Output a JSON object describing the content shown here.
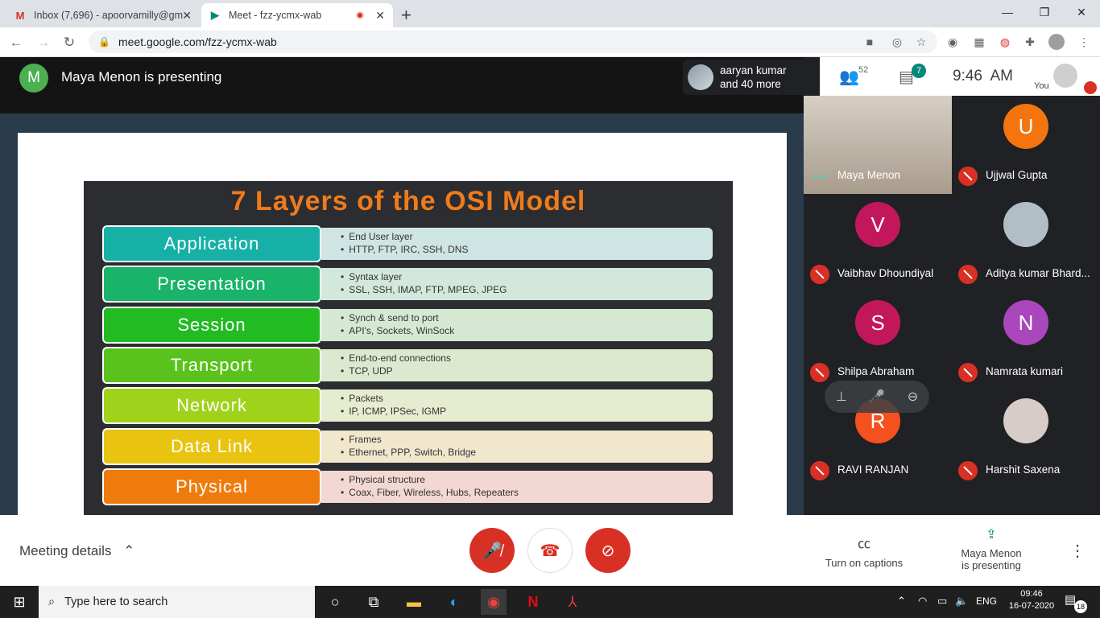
{
  "browser": {
    "tabs": [
      {
        "title": "Inbox (7,696) - apoorvamilly@gm",
        "icon": "gmail-icon"
      },
      {
        "title": "Meet - fzz-ycmx-wab",
        "icon": "meet-icon"
      }
    ],
    "url": "meet.google.com/fzz-ycmx-wab"
  },
  "meet": {
    "presenter_initial": "M",
    "presenting_title": "Maya Menon is presenting",
    "people_preview": "aaryan kumar",
    "people_more": "and 40 more",
    "participant_count": "52",
    "chat_count": "7",
    "time": "9:46  AM",
    "self_label": "You"
  },
  "slide": {
    "title": "7 Layers of the OSI Model",
    "layers": [
      {
        "name": "Application",
        "color": "#16b0a7",
        "desc_bg": "#cfe5e3",
        "items": [
          "End User layer",
          "HTTP, FTP, IRC, SSH, DNS"
        ]
      },
      {
        "name": "Presentation",
        "color": "#19b36a",
        "desc_bg": "#d3e8dc",
        "items": [
          "Syntax layer",
          "SSL, SSH, IMAP, FTP, MPEG, JPEG"
        ]
      },
      {
        "name": "Session",
        "color": "#22bb22",
        "desc_bg": "#d5e9d2",
        "items": [
          "Synch & send to port",
          "API's, Sockets, WinSock"
        ]
      },
      {
        "name": "Transport",
        "color": "#5ac21c",
        "desc_bg": "#dde9cf",
        "items": [
          "End-to-end connections",
          "TCP, UDP"
        ]
      },
      {
        "name": "Network",
        "color": "#9fd21a",
        "desc_bg": "#e6eccf",
        "items": [
          "Packets",
          "IP, ICMP, IPSec, IGMP"
        ]
      },
      {
        "name": "Data Link",
        "color": "#e8c411",
        "desc_bg": "#f0e7cd",
        "items": [
          "Frames",
          "Ethernet, PPP, Switch, Bridge"
        ]
      },
      {
        "name": "Physical",
        "color": "#f07b0d",
        "desc_bg": "#f3d7d2",
        "items": [
          "Physical structure",
          "Coax, Fiber, Wireless, Hubs, Repeaters"
        ]
      }
    ]
  },
  "participants": [
    {
      "name": "Maya Menon",
      "initial": "",
      "color": "",
      "video": true,
      "muted": false
    },
    {
      "name": "Ujjwal Gupta",
      "initial": "U",
      "color": "#f4750f",
      "video": false,
      "muted": true
    },
    {
      "name": "Vaibhav Dhoundiyal",
      "initial": "V",
      "color": "#c2185b",
      "video": false,
      "muted": true
    },
    {
      "name": "Aditya kumar Bhard...",
      "initial": "",
      "color": "#b0bec5",
      "video": false,
      "muted": true
    },
    {
      "name": "Shilpa Abraham",
      "initial": "S",
      "color": "#c2185b",
      "video": false,
      "muted": true
    },
    {
      "name": "Namrata kumari",
      "initial": "N",
      "color": "#ab47bc",
      "video": false,
      "muted": true
    },
    {
      "name": "RAVI RANJAN",
      "initial": "R",
      "color": "#f4511e",
      "video": false,
      "muted": true
    },
    {
      "name": "Harshit Saxena",
      "initial": "",
      "color": "#d7ccc8",
      "video": false,
      "muted": true
    }
  ],
  "bottom": {
    "meeting_details": "Meeting details",
    "captions": "Turn on captions",
    "presenting_line1": "Maya Menon",
    "presenting_line2": "is presenting"
  },
  "taskbar": {
    "search_placeholder": "Type here to search",
    "lang": "ENG",
    "time": "09:46",
    "date": "16-07-2020",
    "notifications": "18"
  }
}
